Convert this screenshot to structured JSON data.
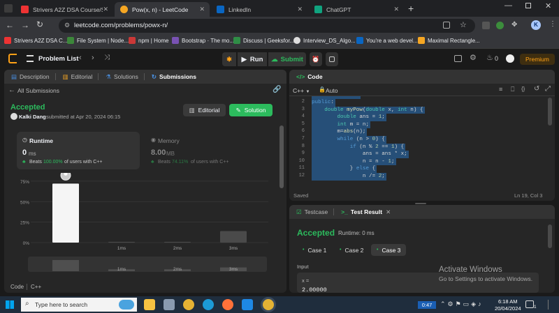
{
  "browser": {
    "tabs": [
      {
        "title": "Strivers A2Z DSA Course/Shee",
        "active": false
      },
      {
        "title": "Pow(x, n) - LeetCode",
        "active": true
      },
      {
        "title": "LinkedIn",
        "active": false
      },
      {
        "title": "ChatGPT",
        "active": false
      }
    ],
    "url": "leetcode.com/problems/powx-n/",
    "profile_initial": "K",
    "bookmarks": [
      "Strivers A2Z DSA C...",
      "File System | Node....",
      "npm | Home",
      "Bootstrap · The mo...",
      "Discuss | Geeksfor...",
      "Interview_DS_Algo...",
      "You're a web devel...",
      "Maximal Rectangle..."
    ]
  },
  "nav": {
    "problem_list": "Problem List",
    "run": "Run",
    "submit": "Submit",
    "fire_count": "0",
    "premium": "Premium"
  },
  "left": {
    "tabs": {
      "description": "Description",
      "editorial": "Editorial",
      "solutions": "Solutions",
      "submissions": "Submissions"
    },
    "all_submissions": "All Submissions",
    "status": "Accepted",
    "user": "Kalki Dang",
    "submitted": "submitted at Apr 20, 2024 06:15",
    "editorial_btn": "Editorial",
    "solution_btn": "Solution",
    "runtime": {
      "label": "Runtime",
      "value": "0",
      "unit": "ms",
      "beats": "Beats",
      "pct": "100.00%",
      "suffix": "of users with C++"
    },
    "memory": {
      "label": "Memory",
      "value": "8.00",
      "unit": "MB",
      "beats": "Beats",
      "pct": "74.11%",
      "suffix": "of users with C++"
    },
    "footer": {
      "label": "Code",
      "lang": "C++"
    }
  },
  "chart_data": {
    "type": "bar",
    "categories": [
      "0ms",
      "1ms",
      "2ms",
      "3ms"
    ],
    "tick_labels": [
      "",
      "1ms",
      "2ms",
      "3ms"
    ],
    "values": [
      72,
      1,
      1,
      14
    ],
    "yticks": [
      "75%",
      "50%",
      "25%",
      "0%"
    ],
    "ylim": [
      0,
      80
    ],
    "highlight_index": 0,
    "mini_values": [
      30,
      5,
      5,
      10
    ],
    "mini_labels": [
      "",
      "1ms",
      "2ms",
      "3ms"
    ]
  },
  "editor": {
    "title": "Code",
    "lang": "C++",
    "mode": "Auto",
    "status": "Saved",
    "cursor": "Ln 19, Col 3",
    "lines": [
      {
        "n": "2",
        "text": "public:"
      },
      {
        "n": "3",
        "text": "    double myPow(double x, int n) {"
      },
      {
        "n": "4",
        "text": "        double ans = 1;"
      },
      {
        "n": "5",
        "text": "        int m = n;"
      },
      {
        "n": "6",
        "text": "        m=abs(n);"
      },
      {
        "n": "7",
        "text": "        while (n > 0) {"
      },
      {
        "n": "8",
        "text": "            if (n % 2 == 1) {"
      },
      {
        "n": "9",
        "text": "                ans = ans * x;"
      },
      {
        "n": "10",
        "text": "                n = n - 1;"
      },
      {
        "n": "11",
        "text": "            } else {"
      },
      {
        "n": "12",
        "text": "                n /= 2;"
      }
    ]
  },
  "result": {
    "tab_testcase": "Testcase",
    "tab_result": "Test Result",
    "status": "Accepted",
    "runtime": "Runtime: 0 ms",
    "cases": [
      "Case 1",
      "Case 2",
      "Case 3"
    ],
    "input_label": "Input",
    "var_label": "x =",
    "var_value": "2.00000"
  },
  "watermark": {
    "line1": "Activate Windows",
    "line2": "Go to Settings to activate Windows."
  },
  "taskbar": {
    "search_placeholder": "Type here to search",
    "battery": "0:47",
    "time": "6:18 AM",
    "date": "20/04/2024",
    "notif": "1"
  }
}
